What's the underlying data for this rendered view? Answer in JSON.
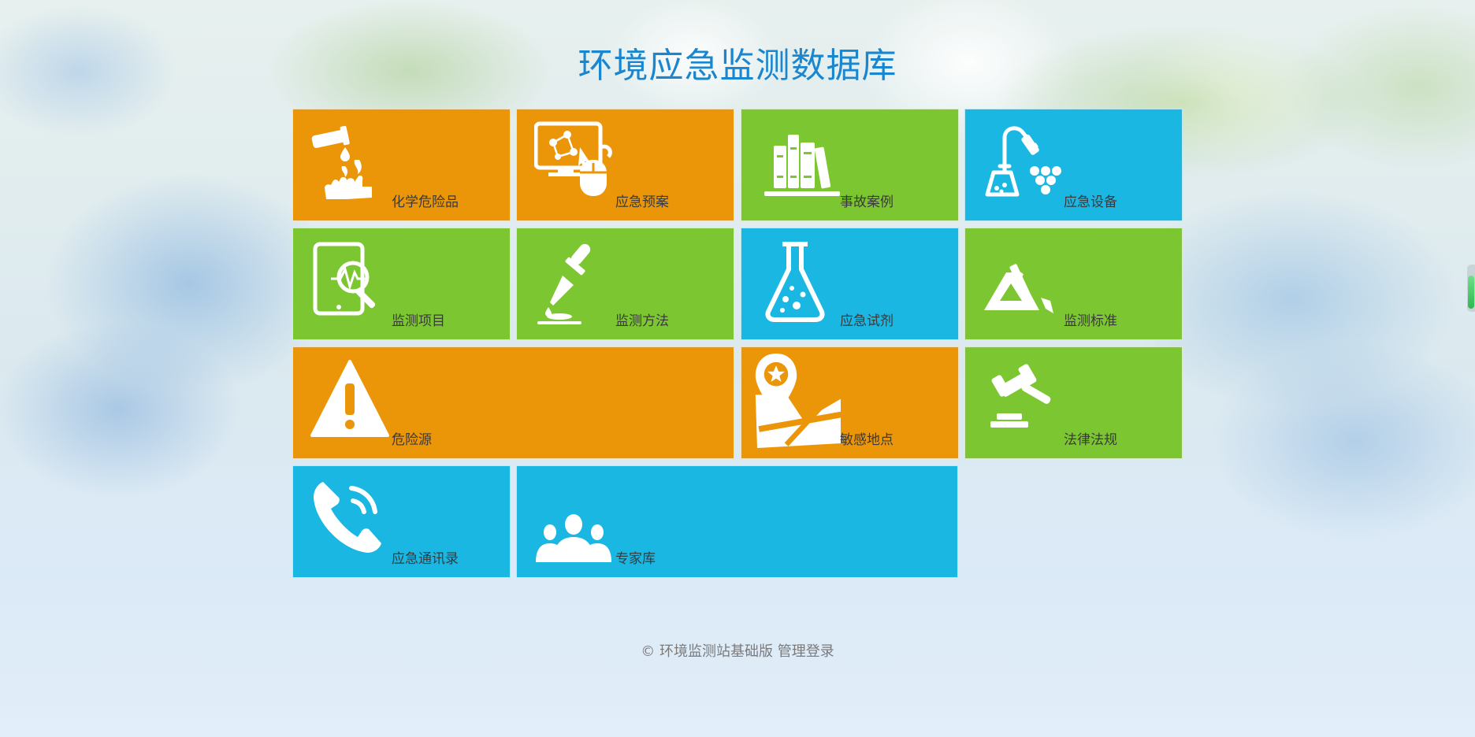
{
  "page": {
    "title": "环境应急监测数据库"
  },
  "tiles": [
    {
      "label": "化学危险品",
      "icon": "chemical-hand-icon",
      "color": "#eb9509"
    },
    {
      "label": "应急预案",
      "icon": "computer-plan-icon",
      "color": "#eb9509"
    },
    {
      "label": "事故案例",
      "icon": "books-icon",
      "color": "#7cc632"
    },
    {
      "label": "应急设备",
      "icon": "lab-equipment-icon",
      "color": "#1bb7e3"
    },
    {
      "label": "监测项目",
      "icon": "tablet-analysis-icon",
      "color": "#7cc632"
    },
    {
      "label": "监测方法",
      "icon": "dropper-icon",
      "color": "#7cc632"
    },
    {
      "label": "应急试剂",
      "icon": "flask-icon",
      "color": "#1bb7e3"
    },
    {
      "label": "监测标准",
      "icon": "drafting-tools-icon",
      "color": "#7cc632"
    },
    {
      "label": "危险源",
      "icon": "warning-icon",
      "color": "#eb9509"
    },
    {
      "label": "敏感地点",
      "icon": "map-pin-icon",
      "color": "#eb9509"
    },
    {
      "label": "法律法规",
      "icon": "gavel-icon",
      "color": "#7cc632"
    },
    {
      "label": "应急通讯录",
      "icon": "phone-icon",
      "color": "#1bb7e3"
    },
    {
      "label": "专家库",
      "icon": "experts-icon",
      "color": "#1bb7e3"
    }
  ],
  "footer": {
    "copyright": "© 环境监测站基础版",
    "admin_link": "管理登录"
  },
  "colors": {
    "title": "#1a86cf",
    "orange": "#eb9509",
    "green": "#7cc632",
    "blue": "#1bb7e3"
  }
}
